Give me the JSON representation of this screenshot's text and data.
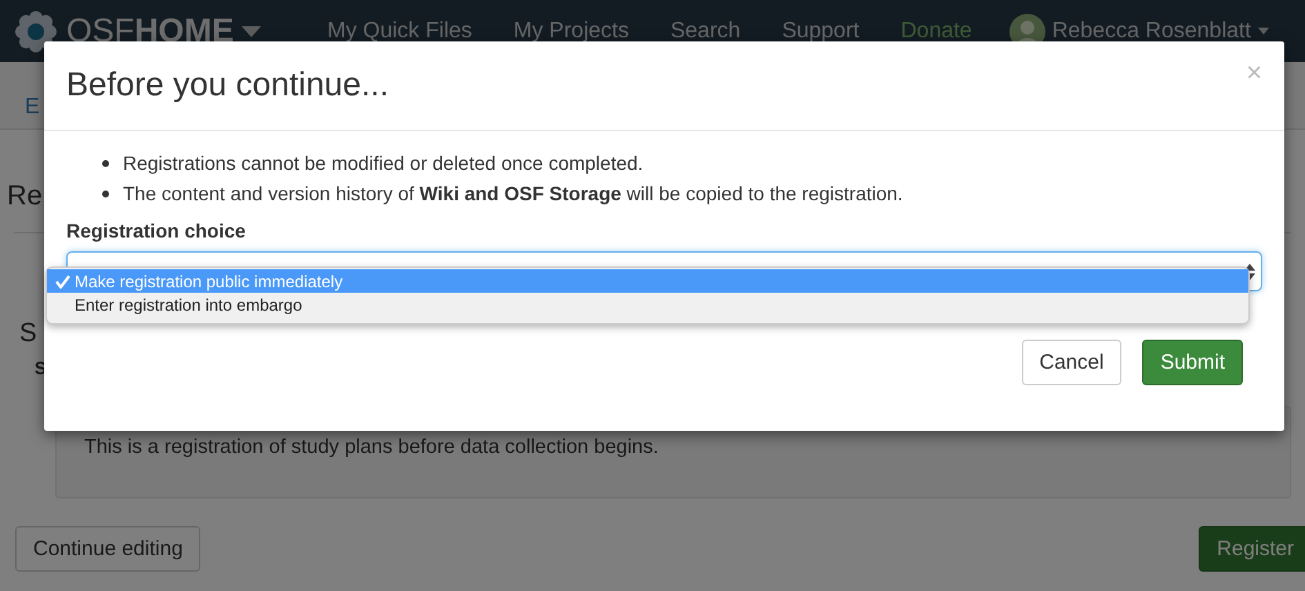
{
  "navbar": {
    "brand": "OSF**HOME**",
    "items": [
      {
        "label": "My Quick Files",
        "kind": "link"
      },
      {
        "label": "My Projects",
        "kind": "link"
      },
      {
        "label": "Search",
        "kind": "link"
      },
      {
        "label": "Support",
        "kind": "link"
      },
      {
        "label": "Donate",
        "kind": "donate"
      }
    ],
    "user": "Rebecca Rosenblatt"
  },
  "page": {
    "subnav_fragment": "E",
    "heading_fragment": "Re",
    "section_fragment": "S",
    "label_fragment": "S",
    "description": "This is a registration of study plans before data collection begins.",
    "buttons": [
      {
        "label": "Continue editing",
        "kind": "default"
      },
      {
        "label": "Register",
        "kind": "primary"
      }
    ]
  },
  "modal": {
    "title": "Before you continue...",
    "close": "×",
    "bullets": [
      "Registrations cannot be modified or deleted once completed.",
      "The content and version history of **Wiki and OSF Storage** will be copied to the registration."
    ],
    "field_label": "Registration choice",
    "options": [
      {
        "label": "Make registration public immediately",
        "selected": true
      },
      {
        "label": "Enter registration into embargo",
        "selected": false
      }
    ],
    "buttons": [
      {
        "label": "Cancel",
        "kind": "default"
      },
      {
        "label": "Submit",
        "kind": "primary"
      }
    ]
  }
}
